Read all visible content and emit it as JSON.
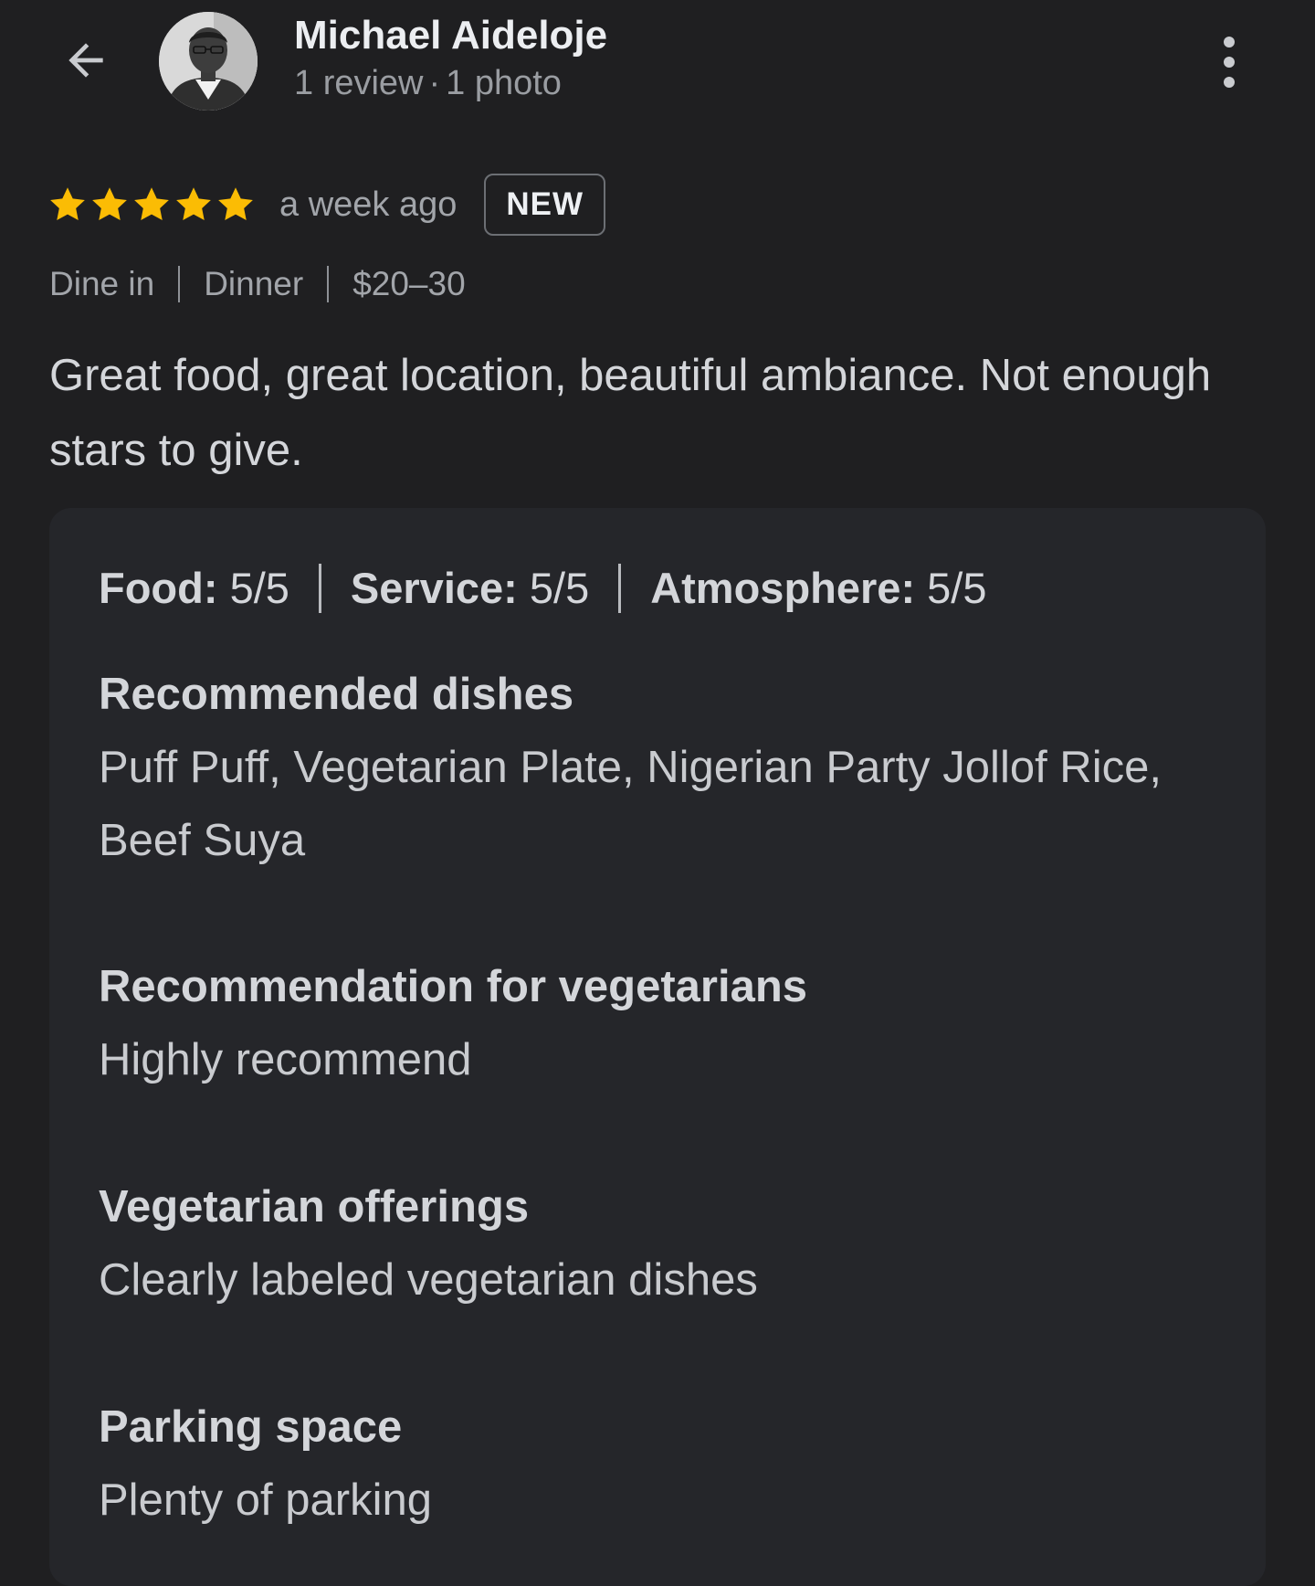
{
  "header": {
    "name": "Michael Aideloje",
    "reviews": "1 review",
    "separator": "·",
    "photos": "1 photo",
    "back_icon": "arrow-left-icon",
    "more_icon": "more-vertical-icon"
  },
  "review": {
    "rating": 5,
    "rating_max": 5,
    "star_color": "#fbbc04",
    "time_ago": "a week ago",
    "badge": "NEW",
    "tags": [
      "Dine in",
      "Dinner",
      "$20–30"
    ],
    "text": "Great food, great location, beautiful ambiance. Not enough stars to give."
  },
  "details": {
    "aspects": [
      {
        "label": "Food:",
        "value": "5/5"
      },
      {
        "label": "Service:",
        "value": "5/5"
      },
      {
        "label": "Atmosphere:",
        "value": "5/5"
      }
    ],
    "sections": [
      {
        "title": "Recommended dishes",
        "value": "Puff Puff, Vegetarian Plate, Nigerian Party Jollof Rice, Beef Suya"
      },
      {
        "title": "Recommendation for vegetarians",
        "value": "Highly recommend"
      },
      {
        "title": "Vegetarian offerings",
        "value": "Clearly labeled vegetarian dishes"
      },
      {
        "title": "Parking space",
        "value": "Plenty of parking"
      }
    ]
  }
}
